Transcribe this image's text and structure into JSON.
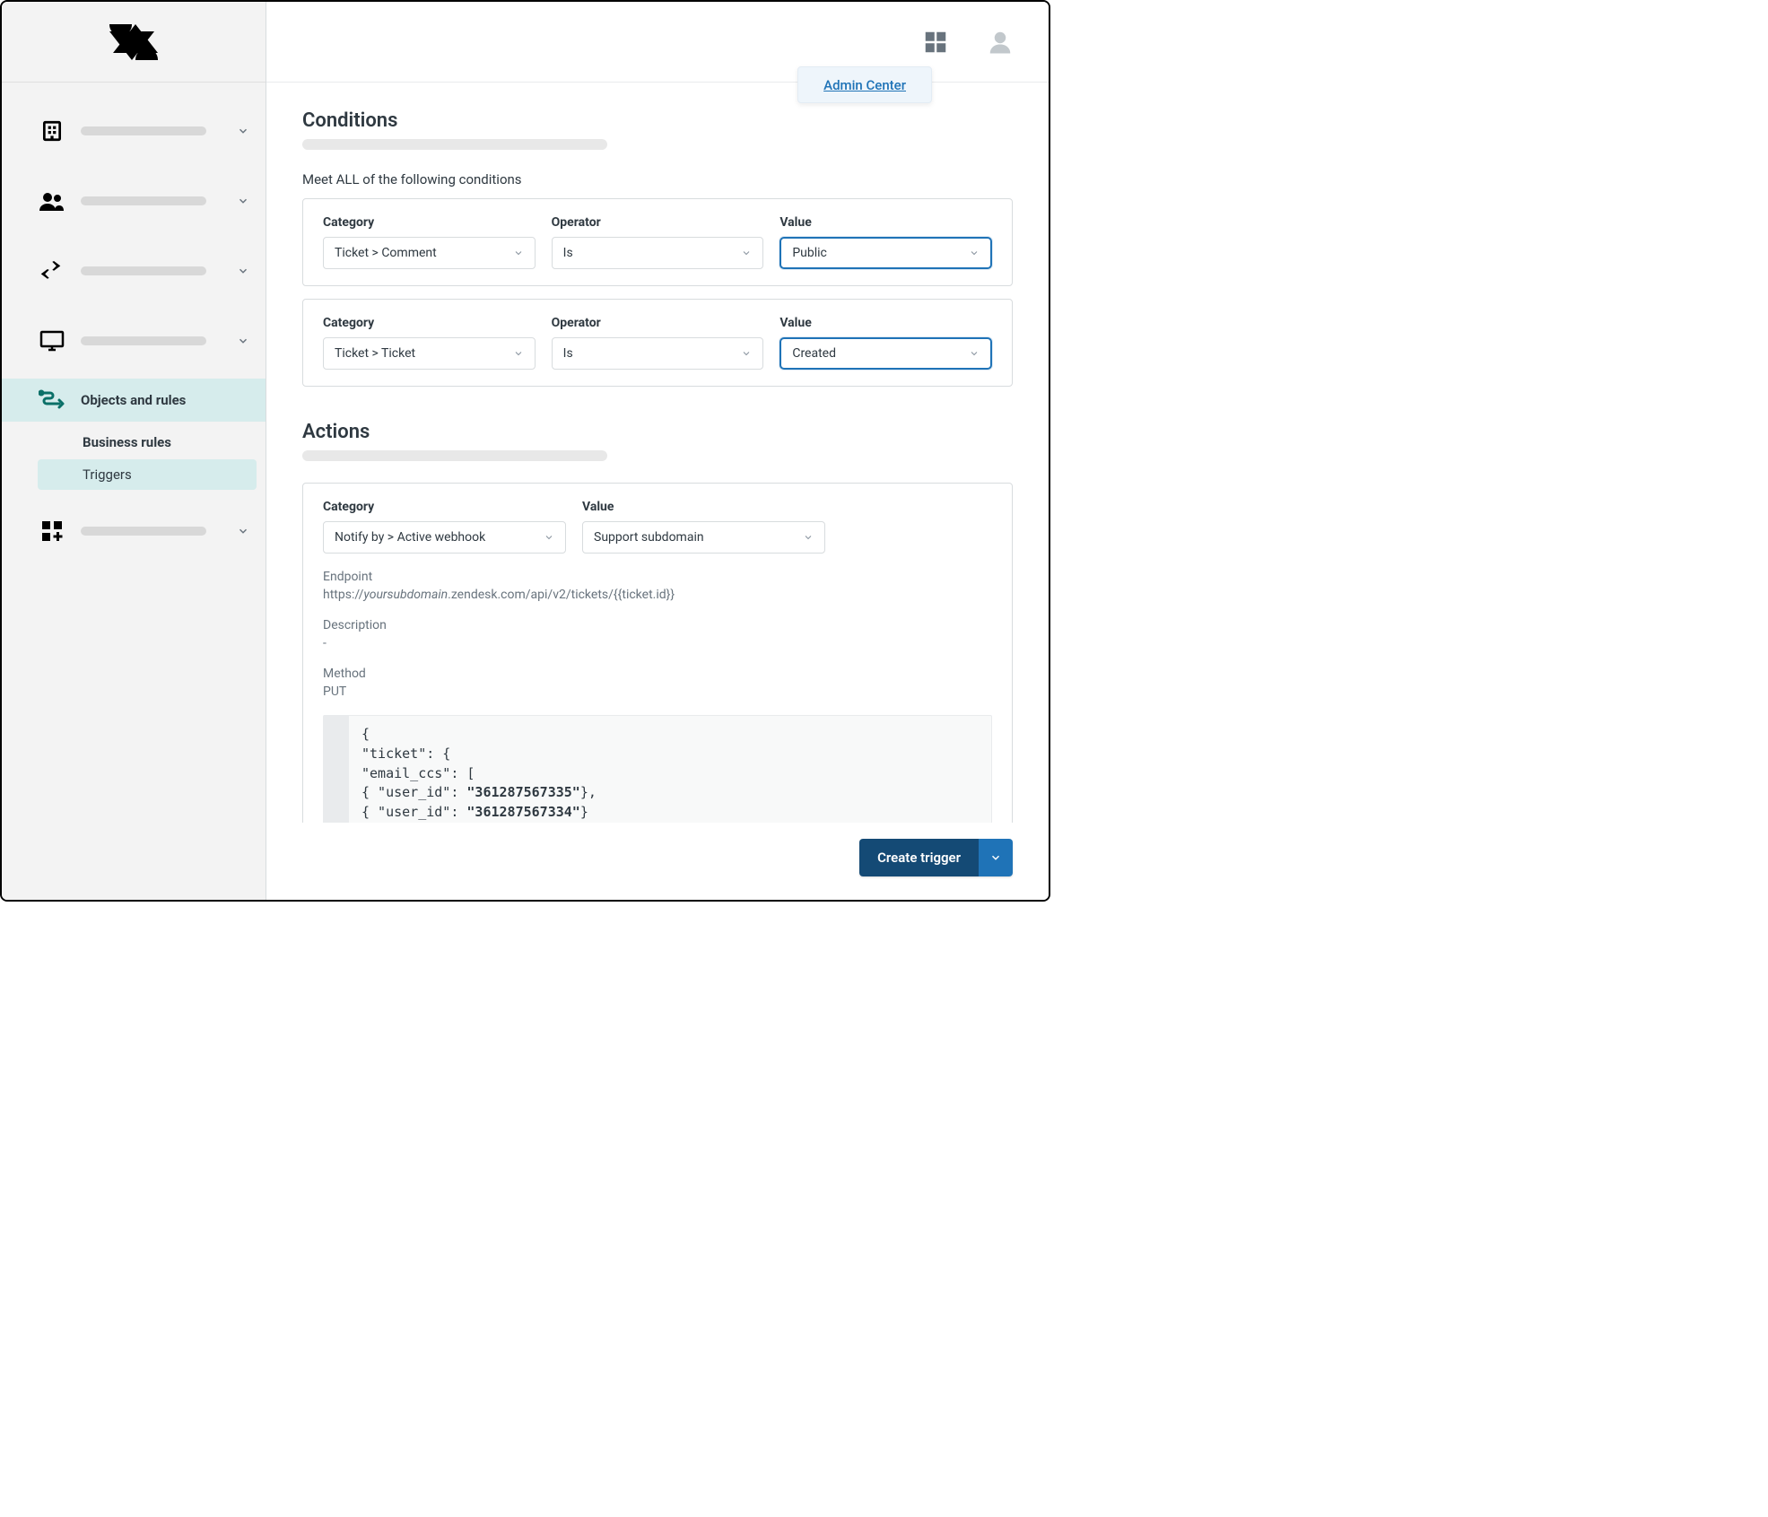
{
  "header": {
    "admin_center_label": "Admin Center"
  },
  "sidebar": {
    "active_label": "Objects and rules",
    "sub_header": "Business rules",
    "sub_selected": "Triggers"
  },
  "conditions": {
    "title": "Conditions",
    "all_label": "Meet ALL of the following conditions",
    "labels": {
      "category": "Category",
      "operator": "Operator",
      "value": "Value"
    },
    "rows": [
      {
        "category": "Ticket > Comment",
        "operator": "Is",
        "value": "Public"
      },
      {
        "category": "Ticket > Ticket",
        "operator": "Is",
        "value": "Created"
      }
    ]
  },
  "actions": {
    "title": "Actions",
    "labels": {
      "category": "Category",
      "value": "Value"
    },
    "row": {
      "category": "Notify by > Active webhook",
      "value": "Support subdomain"
    },
    "endpoint_label": "Endpoint",
    "endpoint_prefix": "https://",
    "endpoint_sub": "yoursubdomain",
    "endpoint_suffix": ".zendesk.com/api/v2/tickets/{{ticket.id}}",
    "description_label": "Description",
    "description_value": "-",
    "method_label": "Method",
    "method_value": "PUT",
    "code": {
      "l1": "{",
      "l2": "\"ticket\": {",
      "l3": "\"email_ccs\": [",
      "l4a": "{ \"user_id\": ",
      "l4b": "\"361287567335\"",
      "l4c": "},",
      "l5a": "{ \"user_id\": ",
      "l5b": "\"361287567334\"",
      "l5c": "}",
      "l6": "]",
      "l7": "}",
      "l8": "}"
    }
  },
  "footer": {
    "create_label": "Create trigger"
  }
}
